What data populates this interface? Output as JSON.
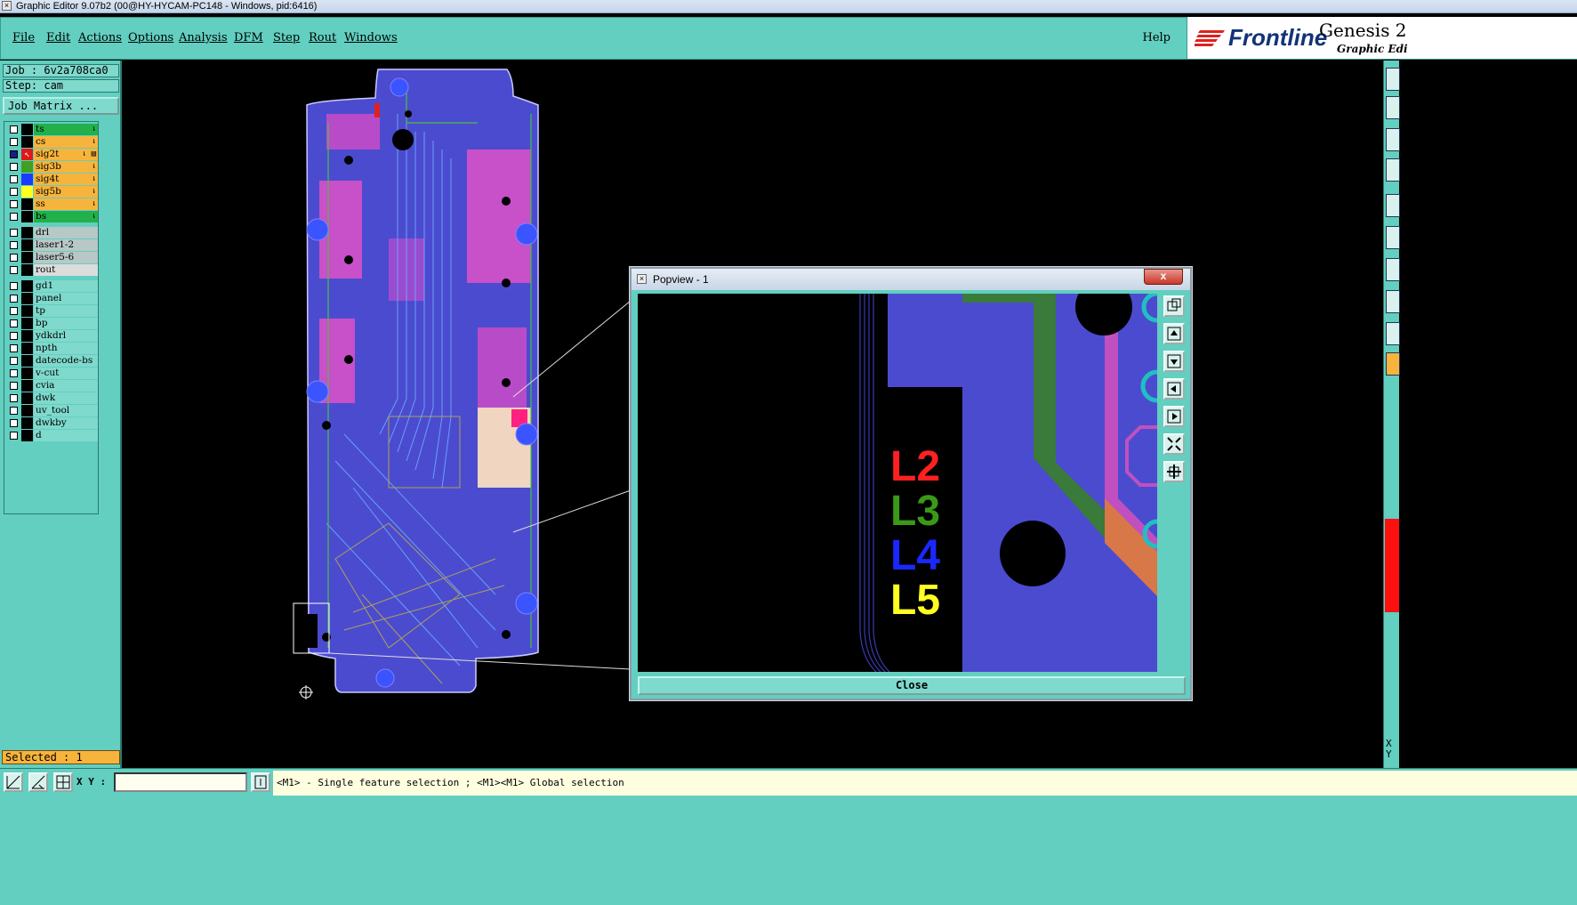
{
  "window": {
    "title": "Graphic Editor 9.07b2 (00@HY-HYCAM-PC148 - Windows, pid:6416)"
  },
  "menu": {
    "items": [
      "File",
      "Edit",
      "Actions",
      "Options",
      "Analysis",
      "DFM",
      "Step",
      "Rout",
      "Windows"
    ],
    "help": "Help"
  },
  "brand": {
    "logo": "Frontline",
    "product": "Genesis 2",
    "subtitle": "Graphic Edi"
  },
  "job": {
    "job_line": "Job : 6v2a708ca0",
    "step_line": "Step: cam",
    "matrix_button": "Job Matrix ..."
  },
  "layers": [
    {
      "name": "ts",
      "color": "#24a046",
      "bg": "#22b04a",
      "icon": "⇂"
    },
    {
      "name": "cs",
      "color": "#f7b43c",
      "bg": "#f7b43c",
      "icon": "⇂"
    },
    {
      "name": "sig2t",
      "color": "#e01818",
      "bg": "#f7b43c",
      "icon": "⇂ ▤"
    },
    {
      "name": "sig3b",
      "color": "#42a020",
      "bg": "#f7b43c",
      "icon": "⇂"
    },
    {
      "name": "sig4t",
      "color": "#1a3aff",
      "bg": "#f7b43c",
      "icon": "⇂"
    },
    {
      "name": "sig5b",
      "color": "#ffff20",
      "bg": "#f7b43c",
      "icon": "⇂"
    },
    {
      "name": "ss",
      "color": "#f7b43c",
      "bg": "#f7b43c",
      "icon": "⇂"
    },
    {
      "name": "bs",
      "color": "#24a046",
      "bg": "#22b04a",
      "icon": "⇂"
    },
    {
      "name": "drl",
      "color": "#7fd9cd",
      "bg": "#b8c8c6",
      "icon": ""
    },
    {
      "name": "laser1-2",
      "color": "#7fd9cd",
      "bg": "#b8c8c6",
      "icon": ""
    },
    {
      "name": "laser5-6",
      "color": "#7fd9cd",
      "bg": "#b8c8c6",
      "icon": ""
    },
    {
      "name": "rout",
      "color": "#7fd9cd",
      "bg": "#dcdcdc",
      "icon": ""
    },
    {
      "name": "gd1",
      "color": "#7fd9cd",
      "bg": "#7fd9cd",
      "icon": ""
    },
    {
      "name": "panel",
      "color": "#7fd9cd",
      "bg": "#7fd9cd",
      "icon": ""
    },
    {
      "name": "tp",
      "color": "#7fd9cd",
      "bg": "#7fd9cd",
      "icon": ""
    },
    {
      "name": "bp",
      "color": "#7fd9cd",
      "bg": "#7fd9cd",
      "icon": ""
    },
    {
      "name": "ydkdrl",
      "color": "#7fd9cd",
      "bg": "#7fd9cd",
      "icon": ""
    },
    {
      "name": "npth",
      "color": "#7fd9cd",
      "bg": "#7fd9cd",
      "icon": ""
    },
    {
      "name": "datecode-bs",
      "color": "#7fd9cd",
      "bg": "#7fd9cd",
      "icon": ""
    },
    {
      "name": "v-cut",
      "color": "#7fd9cd",
      "bg": "#7fd9cd",
      "icon": ""
    },
    {
      "name": "cvia",
      "color": "#7fd9cd",
      "bg": "#7fd9cd",
      "icon": ""
    },
    {
      "name": "dwk",
      "color": "#7fd9cd",
      "bg": "#7fd9cd",
      "icon": ""
    },
    {
      "name": "uv_tool",
      "color": "#7fd9cd",
      "bg": "#7fd9cd",
      "icon": ""
    },
    {
      "name": "dwkby",
      "color": "#7fd9cd",
      "bg": "#7fd9cd",
      "icon": ""
    },
    {
      "name": "d",
      "color": "#7fd9cd",
      "bg": "#7fd9cd",
      "icon": ""
    }
  ],
  "status": {
    "selected": "Selected : 1"
  },
  "bottom": {
    "xy_label": "X Y :",
    "xy_value": "",
    "message": "<M1> - Single feature selection ; <M1><M1> Global selection"
  },
  "right": {
    "xy_label": "X\nY"
  },
  "popview": {
    "title": "Popview - 1",
    "close_x": "x",
    "close_button": "Close",
    "labels": [
      {
        "text": "L2",
        "color": "#ff2020"
      },
      {
        "text": "L3",
        "color": "#3a9a18"
      },
      {
        "text": "L4",
        "color": "#1a28ff"
      },
      {
        "text": "L5",
        "color": "#ffff20"
      }
    ]
  },
  "colors": {
    "panel": "#62cfc0",
    "board": "#4848c8",
    "layer_active": "#f7b43c"
  }
}
